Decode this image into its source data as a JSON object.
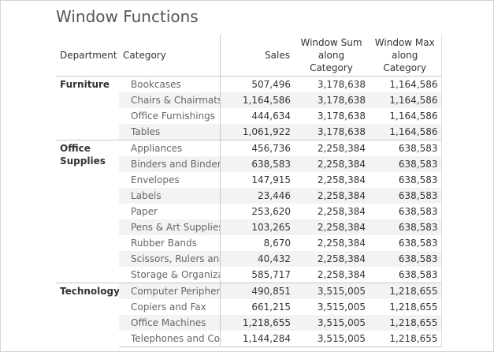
{
  "title": "Window Functions",
  "headers": {
    "department": "Department",
    "category": "Category",
    "sales": "Sales",
    "window_sum_line1": "Window Sum",
    "window_sum_line2": "along Category",
    "window_max_line1": "Window Max",
    "window_max_line2": "along Category"
  },
  "groups": [
    {
      "department_line1": "Furniture",
      "department_line2": "",
      "rows": [
        {
          "category": "Bookcases",
          "sales": "507,496",
          "wsum": "3,178,638",
          "wmax": "1,164,586"
        },
        {
          "category": "Chairs & Chairmats",
          "sales": "1,164,586",
          "wsum": "3,178,638",
          "wmax": "1,164,586"
        },
        {
          "category": "Office Furnishings",
          "sales": "444,634",
          "wsum": "3,178,638",
          "wmax": "1,164,586"
        },
        {
          "category": "Tables",
          "sales": "1,061,922",
          "wsum": "3,178,638",
          "wmax": "1,164,586"
        }
      ]
    },
    {
      "department_line1": "Office",
      "department_line2": "Supplies",
      "rows": [
        {
          "category": "Appliances",
          "sales": "456,736",
          "wsum": "2,258,384",
          "wmax": "638,583"
        },
        {
          "category": "Binders and Binder ..",
          "sales": "638,583",
          "wsum": "2,258,384",
          "wmax": "638,583"
        },
        {
          "category": "Envelopes",
          "sales": "147,915",
          "wsum": "2,258,384",
          "wmax": "638,583"
        },
        {
          "category": "Labels",
          "sales": "23,446",
          "wsum": "2,258,384",
          "wmax": "638,583"
        },
        {
          "category": "Paper",
          "sales": "253,620",
          "wsum": "2,258,384",
          "wmax": "638,583"
        },
        {
          "category": "Pens & Art Supplies",
          "sales": "103,265",
          "wsum": "2,258,384",
          "wmax": "638,583"
        },
        {
          "category": "Rubber Bands",
          "sales": "8,670",
          "wsum": "2,258,384",
          "wmax": "638,583"
        },
        {
          "category": "Scissors, Rulers and ..",
          "sales": "40,432",
          "wsum": "2,258,384",
          "wmax": "638,583"
        },
        {
          "category": "Storage & Organizat..",
          "sales": "585,717",
          "wsum": "2,258,384",
          "wmax": "638,583"
        }
      ]
    },
    {
      "department_line1": "Technology",
      "department_line2": "",
      "rows": [
        {
          "category": "Computer Periphera..",
          "sales": "490,851",
          "wsum": "3,515,005",
          "wmax": "1,218,655"
        },
        {
          "category": "Copiers and Fax",
          "sales": "661,215",
          "wsum": "3,515,005",
          "wmax": "1,218,655"
        },
        {
          "category": "Office Machines",
          "sales": "1,218,655",
          "wsum": "3,515,005",
          "wmax": "1,218,655"
        },
        {
          "category": "Telephones and Com..",
          "sales": "1,144,284",
          "wsum": "3,515,005",
          "wmax": "1,218,655"
        }
      ]
    }
  ]
}
